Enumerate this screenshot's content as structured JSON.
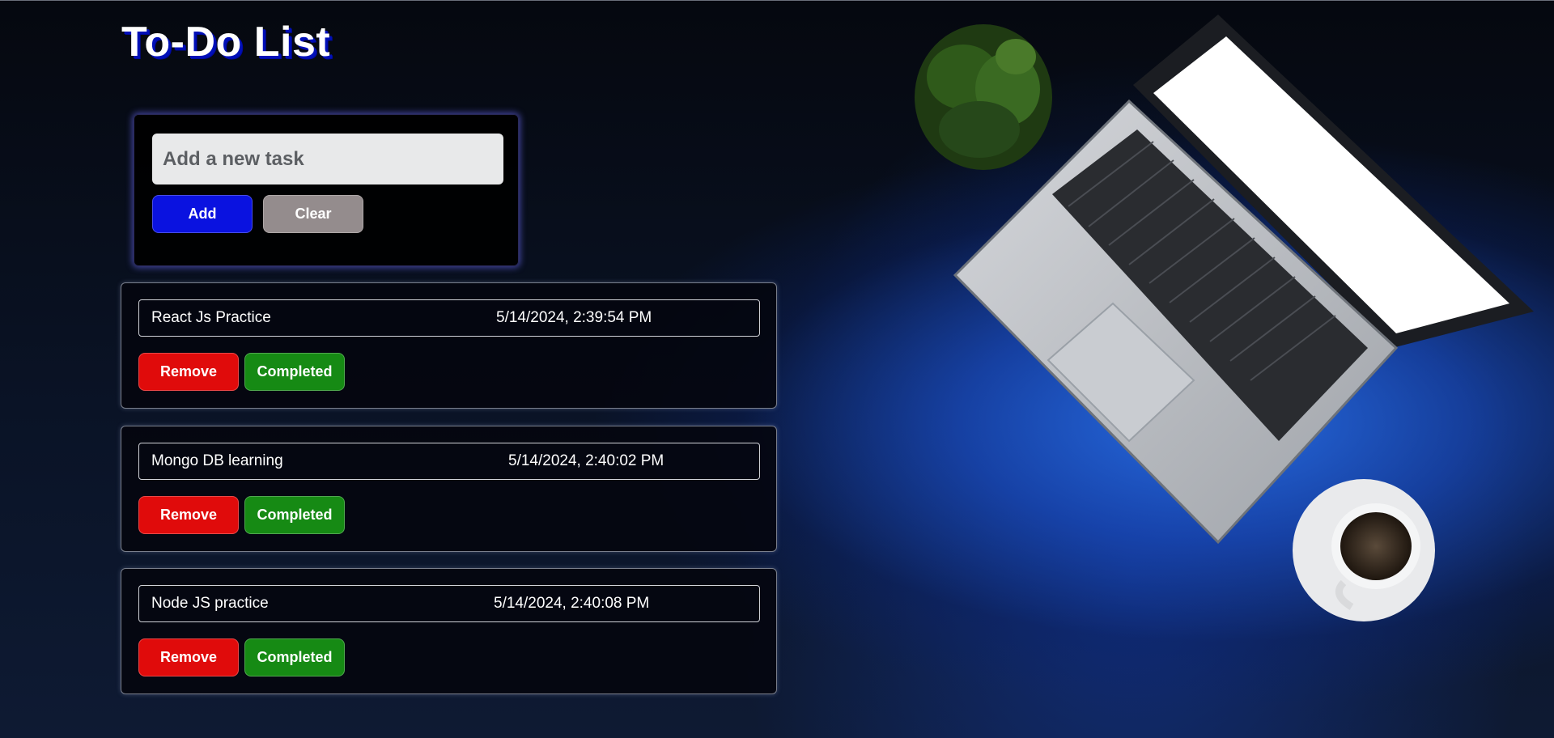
{
  "app": {
    "title": "To-Do List"
  },
  "input_panel": {
    "placeholder": "Add a new task",
    "add_label": "Add",
    "clear_label": "Clear"
  },
  "tasks": [
    {
      "name": "React Js Practice",
      "timestamp": "5/14/2024, 2:39:54 PM",
      "remove_label": "Remove",
      "completed_label": "Completed"
    },
    {
      "name": "Mongo DB learning",
      "timestamp": "5/14/2024, 2:40:02 PM",
      "remove_label": "Remove",
      "completed_label": "Completed"
    },
    {
      "name": "Node JS practice",
      "timestamp": "5/14/2024, 2:40:08 PM",
      "remove_label": "Remove",
      "completed_label": "Completed"
    }
  ],
  "colors": {
    "add_button": "#0a12e0",
    "clear_button": "#948c8d",
    "remove_button": "#e00b0b",
    "completed_button": "#168a14",
    "title_shadow": "#0010b8"
  },
  "background": {
    "image": "desk-with-laptop-plant-coffee"
  }
}
